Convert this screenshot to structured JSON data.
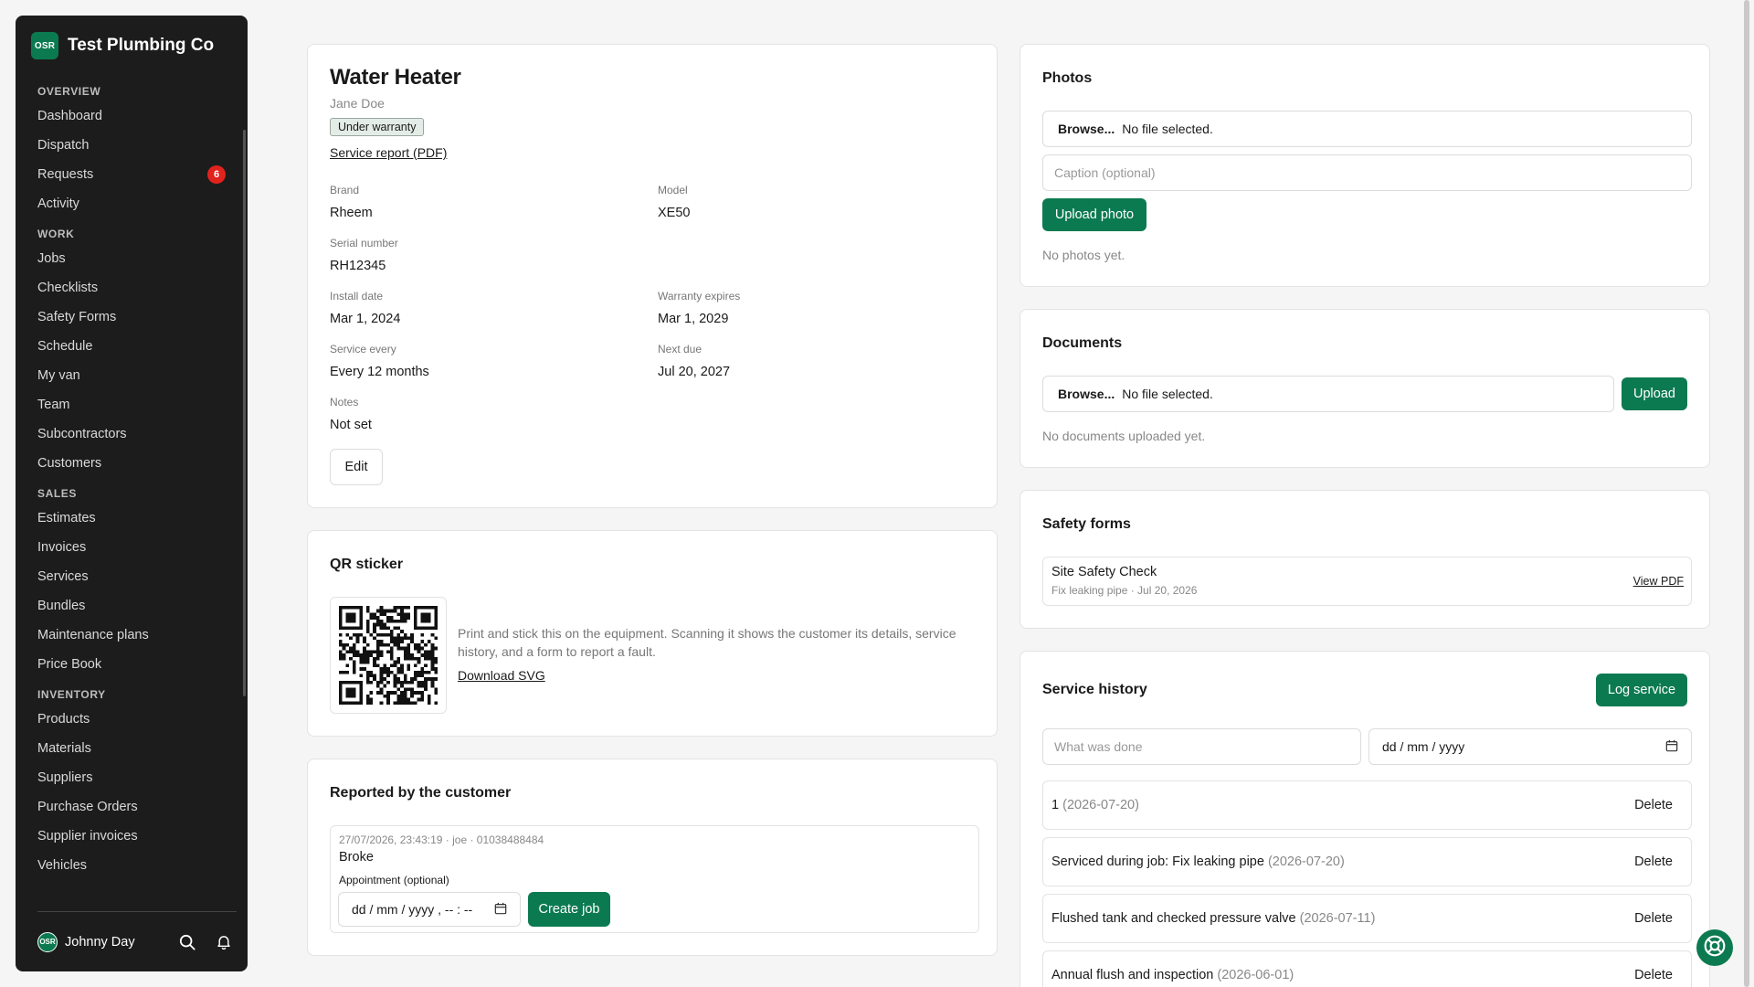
{
  "brand": {
    "logo": "OSR",
    "name": "Test Plumbing Co"
  },
  "sidebar": {
    "sections": [
      {
        "title": "OVERVIEW",
        "items": [
          {
            "label": "Dashboard"
          },
          {
            "label": "Dispatch"
          },
          {
            "label": "Requests",
            "badge": "6"
          },
          {
            "label": "Activity"
          }
        ]
      },
      {
        "title": "WORK",
        "items": [
          {
            "label": "Jobs"
          },
          {
            "label": "Checklists"
          },
          {
            "label": "Safety Forms"
          },
          {
            "label": "Schedule"
          },
          {
            "label": "My van"
          },
          {
            "label": "Team"
          },
          {
            "label": "Subcontractors"
          },
          {
            "label": "Customers"
          }
        ]
      },
      {
        "title": "SALES",
        "items": [
          {
            "label": "Estimates"
          },
          {
            "label": "Invoices"
          },
          {
            "label": "Services"
          },
          {
            "label": "Bundles"
          },
          {
            "label": "Maintenance plans"
          },
          {
            "label": "Price Book"
          }
        ]
      },
      {
        "title": "INVENTORY",
        "items": [
          {
            "label": "Products"
          },
          {
            "label": "Materials"
          },
          {
            "label": "Suppliers"
          },
          {
            "label": "Purchase Orders"
          },
          {
            "label": "Supplier invoices"
          },
          {
            "label": "Vehicles"
          }
        ]
      }
    ],
    "user": {
      "avatar": "OSR",
      "name": "Johnny Day"
    }
  },
  "equipment": {
    "title": "Water Heater",
    "owner": "Jane Doe",
    "status": "Under warranty",
    "report_link": "Service report (PDF)",
    "fields": {
      "brand": {
        "label": "Brand",
        "value": "Rheem"
      },
      "model": {
        "label": "Model",
        "value": "XE50"
      },
      "serial": {
        "label": "Serial number",
        "value": "RH12345"
      },
      "install": {
        "label": "Install date",
        "value": "Mar 1, 2024"
      },
      "warranty": {
        "label": "Warranty expires",
        "value": "Mar 1, 2029"
      },
      "service_every": {
        "label": "Service every",
        "value": "Every 12 months"
      },
      "next_due": {
        "label": "Next due",
        "value": "Jul 20, 2027"
      },
      "notes": {
        "label": "Notes",
        "value": "Not set"
      }
    },
    "edit_label": "Edit"
  },
  "qr": {
    "title": "QR sticker",
    "description": "Print and stick this on the equipment. Scanning it shows the customer its details, service history, and a form to report a fault.",
    "download": "Download SVG"
  },
  "reported": {
    "title": "Reported by the customer",
    "item": {
      "meta": "27/07/2026, 23:43:19 · joe · 01038488484",
      "text": "Broke",
      "appointment_label": "Appointment (optional)",
      "datetime_placeholder": "dd / mm / yyyy ,  -- : --",
      "create_label": "Create job"
    }
  },
  "photos": {
    "title": "Photos",
    "browse": "Browse...",
    "no_file": "No file selected.",
    "caption_placeholder": "Caption (optional)",
    "upload_label": "Upload photo",
    "empty": "No photos yet."
  },
  "documents": {
    "title": "Documents",
    "browse": "Browse...",
    "no_file": "No file selected.",
    "upload_label": "Upload",
    "empty": "No documents uploaded yet."
  },
  "safety": {
    "title": "Safety forms",
    "item": {
      "name": "Site Safety Check",
      "sub": "Fix leaking pipe · Jul 20, 2026",
      "link": "View PDF"
    }
  },
  "history": {
    "title": "Service history",
    "log_label": "Log service",
    "what_placeholder": "What was done",
    "date_placeholder": "dd / mm / yyyy",
    "delete_label": "Delete",
    "rows": [
      {
        "text": "1",
        "date": "(2026-07-20)"
      },
      {
        "text": "Serviced during job: Fix leaking pipe",
        "date": "(2026-07-20)"
      },
      {
        "text": "Flushed tank and checked pressure valve",
        "date": "(2026-07-11)"
      },
      {
        "text": "Annual flush and inspection",
        "date": "(2026-06-01)"
      }
    ]
  },
  "colors": {
    "accent": "#0c7a50",
    "sidebar_bg": "#1c1c1c",
    "badge": "#e0231d"
  },
  "icons": [
    "search-icon",
    "bell-icon",
    "calendar-icon",
    "help-lifebuoy-icon",
    "qr-code"
  ]
}
